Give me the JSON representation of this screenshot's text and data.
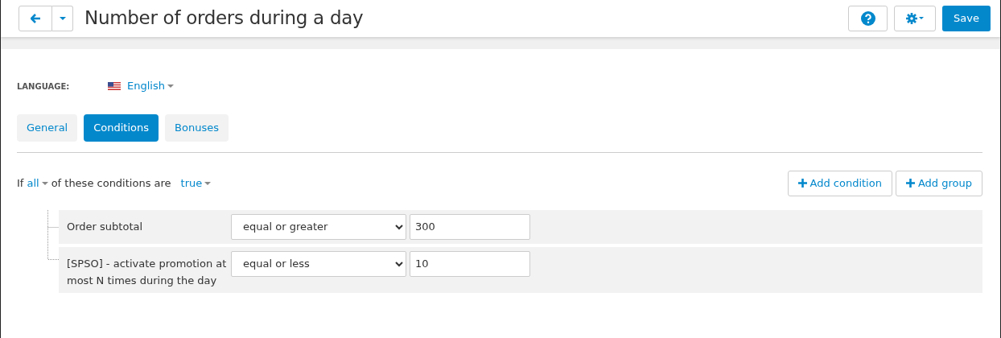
{
  "header": {
    "title": "Number of orders during a day",
    "save_label": "Save"
  },
  "language": {
    "label": "LANGUAGE:",
    "value": "English"
  },
  "tabs": [
    {
      "label": "General",
      "selected": false
    },
    {
      "label": "Conditions",
      "selected": true
    },
    {
      "label": "Bonuses",
      "selected": false
    }
  ],
  "condition_header": {
    "prefix": "If",
    "mode": "all",
    "middle": "of these conditions are",
    "value": "true"
  },
  "actions": [
    "Add condition",
    "Add group"
  ],
  "conditions": [
    {
      "name": "Order subtotal",
      "operator": "equal or greater",
      "value": "300"
    },
    {
      "name": "[SPSO] - activate promotion at most N times during the day",
      "operator": "equal or less",
      "value": "10"
    }
  ]
}
